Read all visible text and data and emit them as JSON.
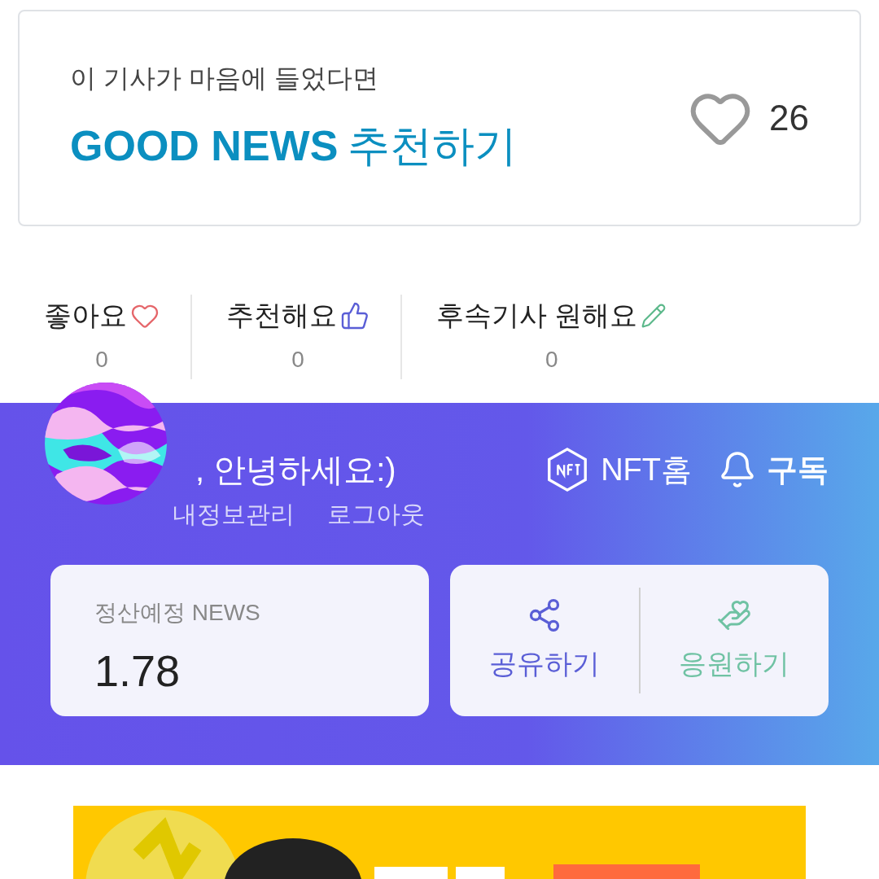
{
  "recommend_card": {
    "prompt": "이 기사가 마음에 들었다면",
    "brand": "GOOD NEWS",
    "action": "추천하기",
    "count": "26"
  },
  "reactions": [
    {
      "kind": "heart",
      "label": "좋아요",
      "count": "0"
    },
    {
      "kind": "thumb",
      "label": "추천해요",
      "count": "0"
    },
    {
      "kind": "pencil",
      "label": "후속기사 원해요",
      "count": "0"
    }
  ],
  "profile": {
    "greeting": ", 안녕하세요:)",
    "links": [
      "내정보관리",
      "로그아웃"
    ],
    "nft_home": "NFT홈",
    "subscribe": "구독"
  },
  "balance": {
    "label": "정산예정 NEWS",
    "value": "1.78"
  },
  "actions": [
    {
      "kind": "share",
      "label": "공유하기"
    },
    {
      "kind": "support",
      "label": "응원하기"
    }
  ]
}
